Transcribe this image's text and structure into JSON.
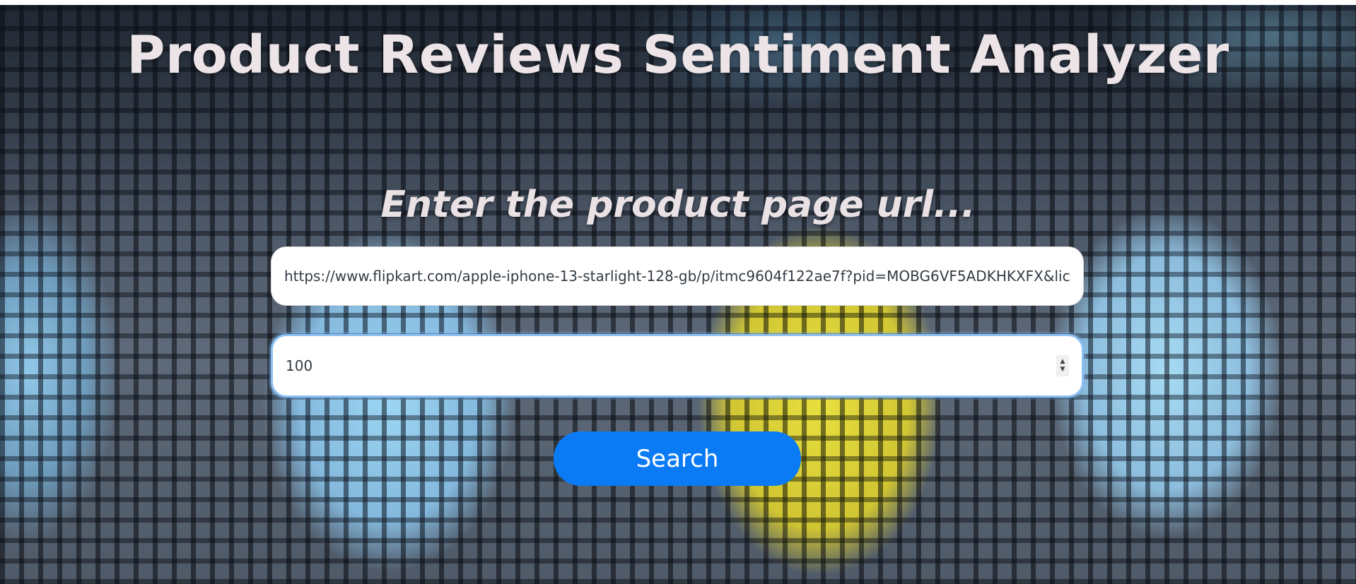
{
  "page": {
    "title": "Product Reviews Sentiment Analyzer",
    "subtitle": "Enter the product page url..."
  },
  "form": {
    "url_value": "https://www.flipkart.com/apple-iphone-13-starlight-128-gb/p/itmc9604f122ae7f?pid=MOBG6VF5ADKHKXFX&lic",
    "count_value": "100",
    "search_label": "Search"
  },
  "icons": {
    "stepper_up": "▲",
    "stepper_down": "▼"
  },
  "colors": {
    "title_text": "#ece4e6",
    "button_bg": "#0a7bf5",
    "focus_ring": "#8ec1f3"
  }
}
